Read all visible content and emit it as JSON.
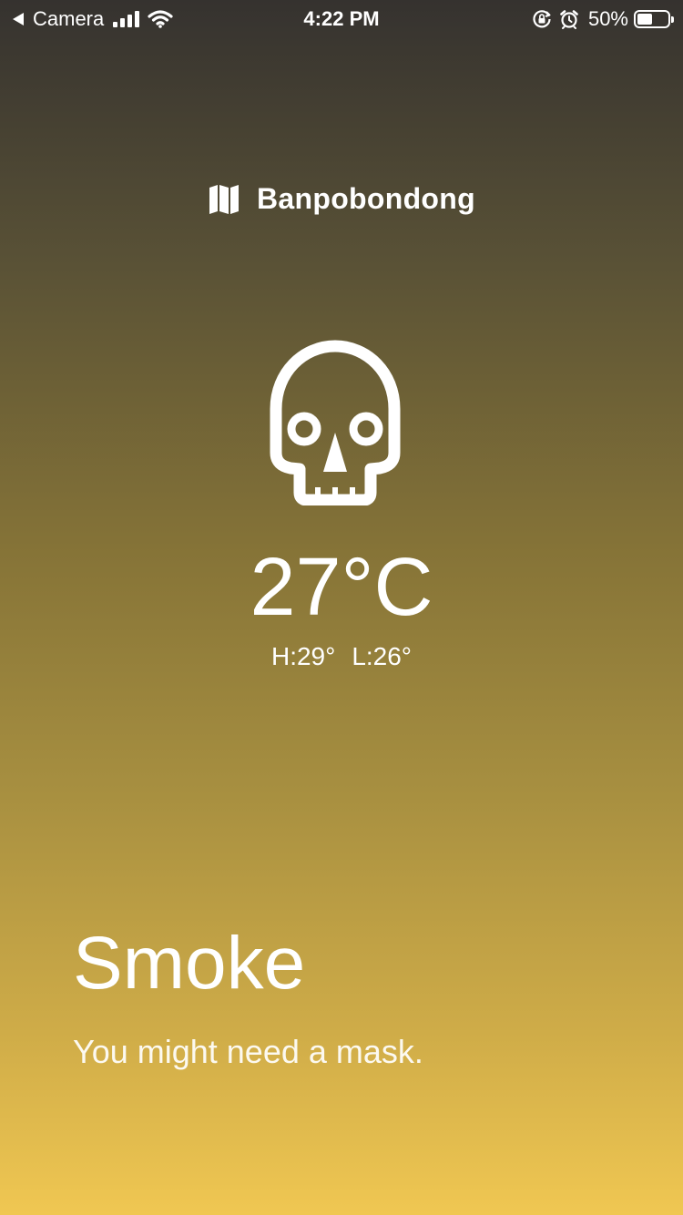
{
  "status_bar": {
    "back_label": "Camera",
    "time": "4:22 PM",
    "battery_label": "50%",
    "battery_level": 0.5,
    "icons": [
      "back-arrow-icon",
      "signal-icon",
      "wifi-icon",
      "orientation-lock-icon",
      "alarm-icon",
      "battery-icon"
    ]
  },
  "location": {
    "icon": "map-icon",
    "name": "Banpobondong"
  },
  "weather": {
    "icon": "skull-icon",
    "temperature": "27°C",
    "high": "H:29°",
    "low": "L:26°",
    "condition": "Smoke",
    "advice": "You might need a mask."
  },
  "colors": {
    "gradient_top": "#35322f",
    "gradient_bottom": "#f0c752",
    "text": "#ffffff"
  }
}
